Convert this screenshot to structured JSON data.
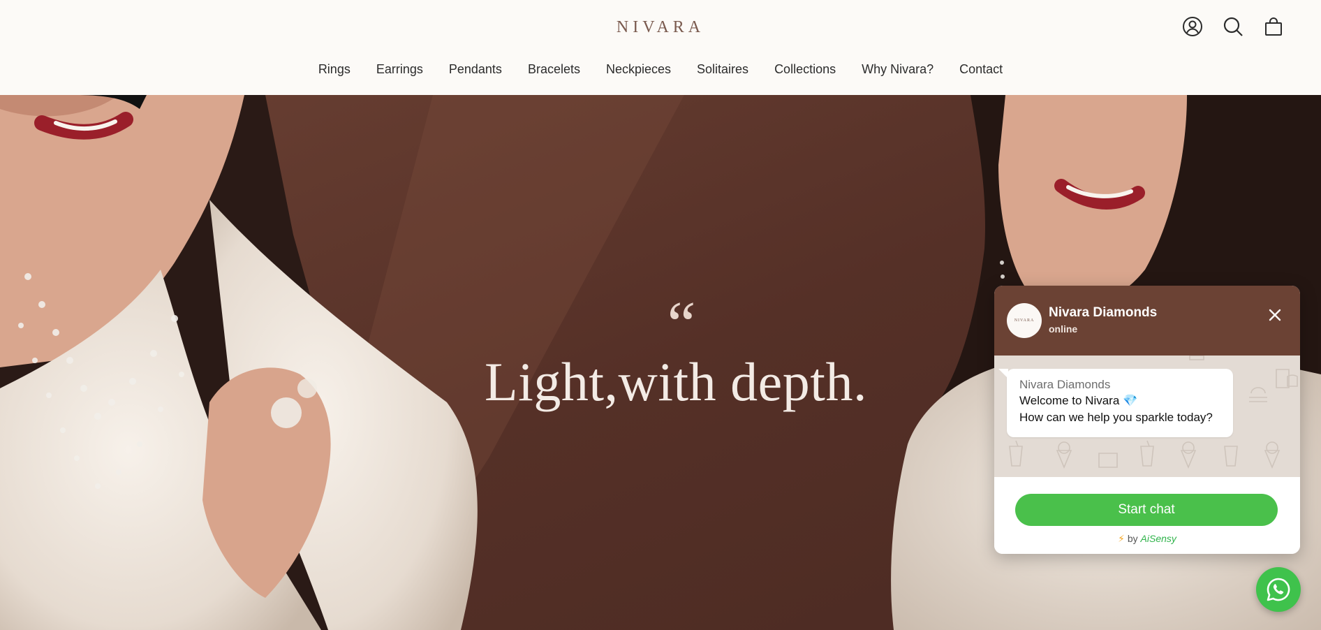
{
  "brand": {
    "logo_text": "NIVARA"
  },
  "header": {
    "icons": [
      "account-icon",
      "search-icon",
      "cart-icon"
    ]
  },
  "nav": {
    "items": [
      {
        "label": "Rings"
      },
      {
        "label": "Earrings"
      },
      {
        "label": "Pendants"
      },
      {
        "label": "Bracelets"
      },
      {
        "label": "Neckpieces"
      },
      {
        "label": "Solitaires"
      },
      {
        "label": "Collections"
      },
      {
        "label": "Why Nivara?"
      },
      {
        "label": "Contact"
      }
    ]
  },
  "hero": {
    "quote_mark": "“",
    "title": "Light,with depth.",
    "background_color": "#5a3429"
  },
  "chat": {
    "avatar_text": "NIVARA",
    "name": "Nivara Diamonds",
    "status": "online",
    "message": {
      "sender": "Nivara Diamonds",
      "line1": "Welcome to Nivara 💎",
      "line2": "How can we help you sparkle today?"
    },
    "start_button": "Start chat",
    "powered_bolt": "⚡",
    "powered_by": "by",
    "powered_brand": "AiSensy",
    "header_color": "#6b4234",
    "accent_color": "#4ac04b"
  }
}
